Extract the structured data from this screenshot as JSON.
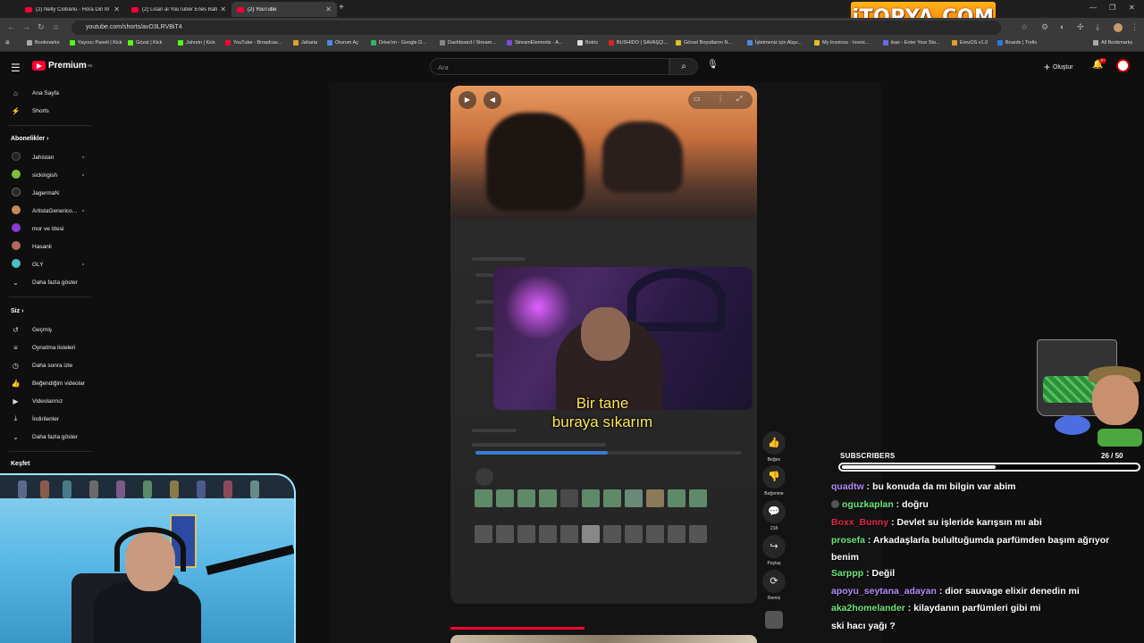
{
  "browser": {
    "tabs": [
      {
        "title": "(2) Nelly Ciobanu - Hora Din M"
      },
      {
        "title": "(2) Lisan al YouTuber Enes Batu"
      },
      {
        "title": "(2) YouTube"
      }
    ],
    "url": "youtube.com/shorts/avO3LRVBiT4",
    "bookmarks": [
      "Bookmarks",
      "Yayıncı Paneli | Kick",
      "Gözat | Kick",
      "Jahrein | Kick",
      "YouTube - Broadcas...",
      "Jaharia",
      "Oturum Aç",
      "Drive'ım - Google D...",
      "Dashboard / Stream...",
      "StreamElements - A...",
      "Botrix",
      "BUSHIDO | SAVAŞÇI...",
      "Görsel Boyutlarını N...",
      "İşletmeniz için Alışv...",
      "My Invoices - Invoic...",
      "ikas - Enter Your Sto...",
      "EmuOS v1.0",
      "Boards | Trello"
    ],
    "all_bookmarks": "All Bookmarks"
  },
  "overlay_brand": "iTOPYA.COM",
  "youtube": {
    "logo_label": "Premium",
    "logo_sup": "TR",
    "search_placeholder": "Ara",
    "create_label": "Oluştur",
    "notif_count": "9+"
  },
  "sidebar": {
    "main": [
      {
        "label": "Ana Sayfa",
        "icon": "home-icon",
        "glyph": "⌂"
      },
      {
        "label": "Shorts",
        "icon": "shorts-icon",
        "glyph": "⚡"
      }
    ],
    "subs_title": "Abonelikler",
    "subs": [
      {
        "label": "Jahistan",
        "color": "#222222"
      },
      {
        "label": "sickingish",
        "color": "#7fbf3a"
      },
      {
        "label": "JagermaN",
        "color": "#2a2a2a"
      },
      {
        "label": "ArtistaGenerico...",
        "color": "#c58a5a"
      },
      {
        "label": "mor ve ötesi",
        "color": "#8a3ad0"
      },
      {
        "label": "Hasanli",
        "color": "#b06a5a"
      },
      {
        "label": "GLY",
        "color": "#4ac0c0"
      }
    ],
    "more_subs": "Daha fazla göster",
    "you_title": "Siz",
    "you": [
      {
        "label": "Geçmiş",
        "icon": "history-icon",
        "glyph": "↺"
      },
      {
        "label": "Oynatma listeleri",
        "icon": "playlist-icon",
        "glyph": "≡"
      },
      {
        "label": "Daha sonra izle",
        "icon": "watch-later-icon",
        "glyph": "◷"
      },
      {
        "label": "Beğendiğim videolar",
        "icon": "liked-icon",
        "glyph": "👍"
      },
      {
        "label": "Videolarınız",
        "icon": "your-videos-icon",
        "glyph": "▶"
      },
      {
        "label": "İndirilenler",
        "icon": "download-icon",
        "glyph": "⤓"
      }
    ],
    "more_you": "Daha fazla göster",
    "explore_title": "Keşfet"
  },
  "short": {
    "caption_line1": "Bir tane",
    "caption_line2": "buraya sıkarım"
  },
  "actions": [
    {
      "label": "Beğen",
      "icon": "like-icon",
      "glyph": "👍"
    },
    {
      "label": "Beğenme",
      "icon": "dislike-icon",
      "glyph": "👎"
    },
    {
      "label": "218",
      "icon": "comment-icon",
      "glyph": "💬"
    },
    {
      "label": "Paylaş",
      "icon": "share-icon",
      "glyph": "↪"
    },
    {
      "label": "Remix",
      "icon": "remix-icon",
      "glyph": "⟳"
    }
  ],
  "subscribers": {
    "title": "SUBSCRIBERS",
    "count": "26 / 50",
    "progress": 0.52
  },
  "chat": [
    {
      "user": "quadtw",
      "color": "#b48cff",
      "text": " : bu konuda da mı bilgin var abim"
    },
    {
      "user": "oguzkaplan",
      "color": "#6fe87a",
      "text": " : doğru",
      "badge": true
    },
    {
      "user": "Boxx_Bunny",
      "color": "#e0284a",
      "text": " : Devlet su işleride karışsın mı abi"
    },
    {
      "user": "prosefa",
      "color": "#6fe87a",
      "text": " : Arkadaşlarla bulultuğumda parfümden başım ağrıyor benim",
      "wrap": true
    },
    {
      "user": "Sarppp",
      "color": "#6fe87a",
      "text": " : Değil"
    },
    {
      "user": "apoyu_seytana_adayan",
      "color": "#b48cff",
      "text": " : dior sauvage elixir denedin mi"
    },
    {
      "user": "aka2homelander",
      "color": "#6fe87a",
      "text": " : kilaydanın parfümleri gibi mi"
    },
    {
      "user": "",
      "color": "#ffffff",
      "text": "ski hacı yağı ?"
    }
  ]
}
